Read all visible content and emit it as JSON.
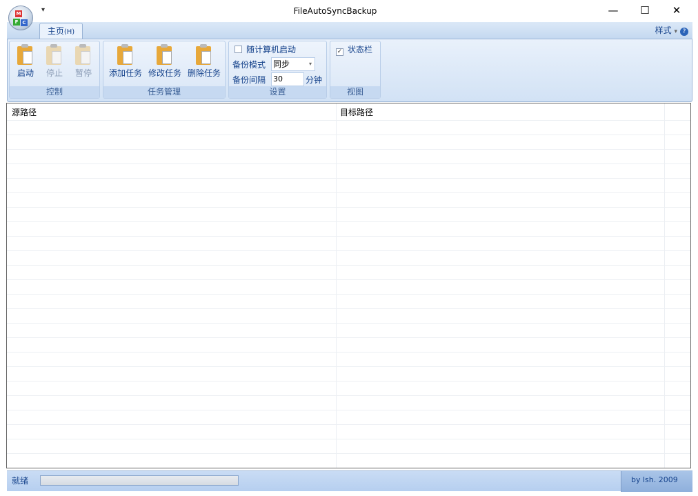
{
  "window": {
    "title": "FileAutoSyncBackup",
    "minimize": "—",
    "maximize": "☐",
    "close": "✕",
    "qat": "▾"
  },
  "orb_letters": [
    "M",
    "F",
    "C"
  ],
  "tabs": [
    {
      "label": "主页",
      "shortcut": "(H)"
    }
  ],
  "style_menu": {
    "label": "样式",
    "arrow": "▾",
    "help": "?"
  },
  "groups": {
    "control": {
      "label": "控制",
      "buttons": [
        "启动",
        "停止",
        "暂停"
      ]
    },
    "task": {
      "label": "任务管理",
      "buttons": [
        "添加任务",
        "修改任务",
        "删除任务"
      ]
    },
    "settings": {
      "label": "设置",
      "autostart": "随计算机启动",
      "mode_label": "备份模式",
      "mode_value": "同步",
      "mode_arrow": "▾",
      "interval_label": "备份间隔",
      "interval_value": "30",
      "interval_unit": "分钟"
    },
    "view": {
      "label": "视图",
      "statusbar": "状态栏",
      "statusbar_check": "✓"
    }
  },
  "table": {
    "columns": [
      "源路径",
      "目标路径"
    ],
    "rows": []
  },
  "statusbar": {
    "text": "就绪",
    "progress": 0,
    "credit": "by lsh. 2009"
  }
}
